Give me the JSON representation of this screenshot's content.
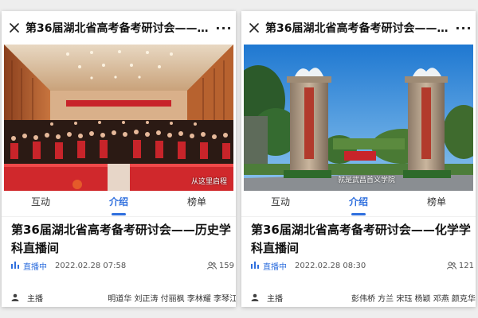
{
  "panels": [
    {
      "header": {
        "title": "第36届湖北省高考备考研讨会——历史学科直播间",
        "close_icon": "close-icon",
        "more_icon": "more-icon",
        "more_label": "···"
      },
      "banner": {
        "caption": "从这里启程"
      },
      "tabs": [
        {
          "label": "互动",
          "active": false
        },
        {
          "label": "介绍",
          "active": true
        },
        {
          "label": "榜单",
          "active": false
        }
      ],
      "heading": "第36届湖北省高考备考研讨会——历史学科直播间",
      "status": {
        "label": "直播中",
        "time": "2022.02.28 07:58",
        "viewers": "159"
      },
      "hosts": {
        "label": "主播",
        "names": "明道华 刘正涛 付丽枫 李林耀 李琴江"
      }
    },
    {
      "header": {
        "title": "第36届湖北省高考备考研讨会——化学学科直播间",
        "close_icon": "close-icon",
        "more_icon": "more-icon",
        "more_label": "···"
      },
      "banner": {
        "caption": "就是武昌首义学院"
      },
      "tabs": [
        {
          "label": "互动",
          "active": false
        },
        {
          "label": "介绍",
          "active": true
        },
        {
          "label": "榜单",
          "active": false
        }
      ],
      "heading": "第36届湖北省高考备考研讨会——化学学科直播间",
      "status": {
        "label": "直播中",
        "time": "2022.02.28 08:30",
        "viewers": "121"
      },
      "hosts": {
        "label": "主播",
        "names": "彭伟桥 方兰 宋珏 杨颖 邓燕 颜克华"
      }
    }
  ],
  "colors": {
    "accent": "#2f6fde",
    "stage_red": "#c8242a",
    "sky_blue": "#2d86d8"
  }
}
